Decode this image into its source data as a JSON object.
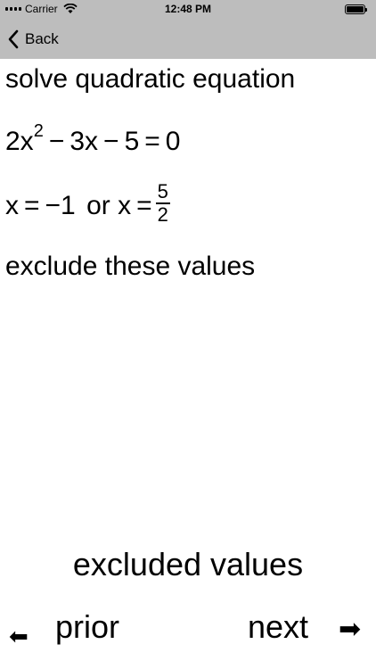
{
  "status_bar": {
    "carrier": "Carrier",
    "time": "12:48 PM",
    "icons": [
      "signal-icon",
      "wifi-icon",
      "battery-icon"
    ]
  },
  "nav": {
    "back_label": "Back"
  },
  "content": {
    "title": "solve quadratic equation",
    "equation": {
      "coef_a": "2x",
      "exponent": "2",
      "minus1": "−",
      "term_b": "3x",
      "minus2": "−",
      "term_c": "5",
      "equals": "=",
      "rhs": "0"
    },
    "solution": {
      "x1_label": "x",
      "equals1": "=",
      "x1_value": "−1",
      "or": "or",
      "x2_label": "x",
      "equals2": "=",
      "x2_num": "5",
      "x2_den": "2"
    },
    "instruction": "exclude these values"
  },
  "footer": {
    "label": "excluded values",
    "prior_arrow": "⬅",
    "prior_label": "prior",
    "next_label": "next",
    "next_arrow": "➡"
  }
}
